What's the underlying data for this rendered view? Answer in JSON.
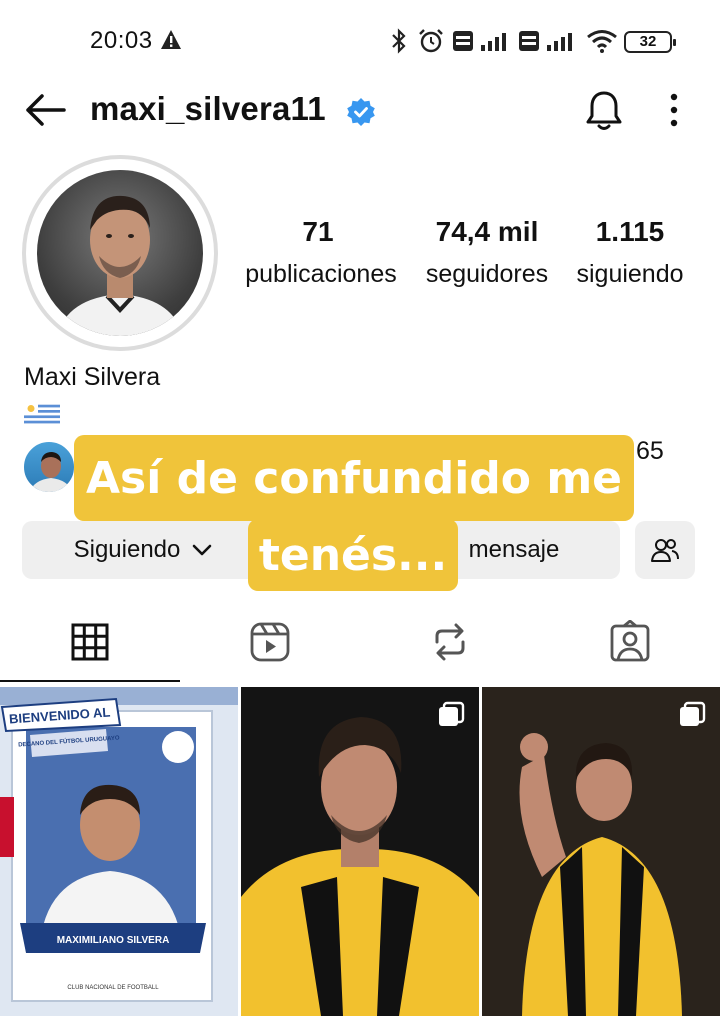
{
  "status_bar": {
    "time": "20:03",
    "battery": "32",
    "icons": [
      "warning-icon",
      "bluetooth-icon",
      "alarm-icon",
      "volte-icon",
      "signal-icon",
      "volte-icon",
      "signal-icon",
      "wifi-icon",
      "battery-icon"
    ]
  },
  "header": {
    "username": "maxi_silvera11",
    "verified": true,
    "icons": [
      "back-arrow-icon",
      "verified-badge-icon",
      "bell-icon",
      "more-vertical-icon"
    ]
  },
  "profile": {
    "display_name": "Maxi Silvera",
    "bio_flag": "uruguay-flag",
    "stats": [
      {
        "value": "71",
        "label": "publicaciones"
      },
      {
        "value": "74,4 mil",
        "label": "seguidores"
      },
      {
        "value": "1.115",
        "label": "siguiendo"
      }
    ],
    "followed_by_count_fragment": "65"
  },
  "buttons": {
    "following": "Siguiendo",
    "message": "mensaje"
  },
  "caption_overlay": {
    "line1": "Así de confundido me",
    "line2": "tenés..."
  },
  "tabs": [
    "grid-icon",
    "reels-icon",
    "reposts-icon",
    "tagged-icon"
  ],
  "colors": {
    "verified_blue": "#3897f0",
    "caption_bg": "#f0c43a",
    "button_bg": "#efefef"
  },
  "posts": {
    "tile1_text": {
      "banner": "BIENVENIDO AL",
      "subtitle": "DECANO DEL FÚTBOL URUGUAYO",
      "name": "MAXIMILIANO SILVERA",
      "footer": "CLUB NACIONAL DE FOOTBALL"
    }
  }
}
